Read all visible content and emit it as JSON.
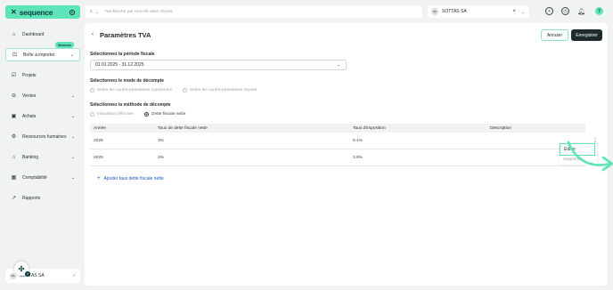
{
  "brand": {
    "name": "sequence",
    "logo_mark": "⌘"
  },
  "colors": {
    "accent": "#5fe3b9",
    "dark": "#1f2a2a",
    "link": "#1e56c4",
    "panel": "#ffffff",
    "bg": "#f1f2f2"
  },
  "sidebar": {
    "items": [
      {
        "label": "Dashboard",
        "icon": "home-icon"
      },
      {
        "label": "Boîte à importer",
        "icon": "inbox-icon",
        "badge": "Nouveau"
      },
      {
        "label": "Projets",
        "icon": "check-square-icon"
      },
      {
        "label": "Ventes",
        "icon": "bag-icon"
      },
      {
        "label": "Achats",
        "icon": "cart-icon"
      },
      {
        "label": "Ressources humaines",
        "icon": "gear-icon"
      },
      {
        "label": "Banking",
        "icon": "bank-icon"
      },
      {
        "label": "Comptabilité",
        "icon": "calculator-icon"
      },
      {
        "label": "Rapports",
        "icon": "chart-line-icon"
      }
    ],
    "footer": {
      "avatar": "SS",
      "label": "SOTTAS SA"
    },
    "help_count": "4"
  },
  "topbar": {
    "search_placeholder": "Recherche par mot-clé dans clients",
    "company": {
      "avatar": "SS",
      "name": "SOTTAS SA"
    }
  },
  "page": {
    "title": "Paramètres TVA",
    "cancel_label": "Annuler",
    "save_label": "Enregistrer"
  },
  "period": {
    "label": "Sélectionnez la période fiscale",
    "value": "01.01.2025 - 31.12.2025"
  },
  "count_mode": {
    "label": "Sélectionnez le mode de décompte",
    "options": [
      "Selon les contre-prestations convenues",
      "Selon les contre-prestations reçues"
    ]
  },
  "method": {
    "label": "Sélectionnez la méthode de décompte",
    "options": [
      "Imposition effective",
      "Dette fiscale nette"
    ],
    "selected": "Dette fiscale nette"
  },
  "table": {
    "headers": [
      "Année",
      "Taux de dette fiscale nette",
      "Taux d'imposition",
      "Description"
    ],
    "rows": [
      [
        "2025",
        "3%",
        "8.1%",
        ""
      ],
      [
        "2025",
        "3%",
        "3.8%",
        ""
      ]
    ]
  },
  "row_menu": {
    "edit_label": "Editer",
    "delete_label": "Supprimer"
  },
  "add_link": "Ajouter taux dette fiscale nette"
}
